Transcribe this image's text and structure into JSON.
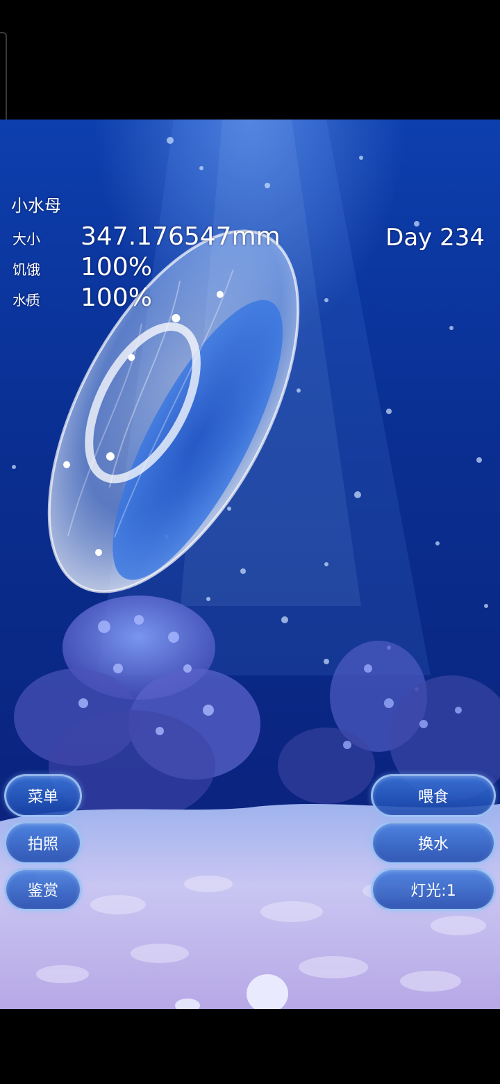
{
  "hud": {
    "pet_name": "小水母",
    "size_label": "大小",
    "size_value": "347.176547mm",
    "hunger_label": "饥饿",
    "hunger_value": "100%",
    "water_label": "水质",
    "water_value": "100%",
    "day": "Day 234"
  },
  "left_buttons": {
    "menu": "菜单",
    "photo": "拍照",
    "appreciate": "鉴赏"
  },
  "right_buttons": {
    "feed": "喂食",
    "change_water": "换水",
    "light": "灯光:1"
  },
  "colors": {
    "water_top": "#0d3fae",
    "water_bottom": "#16227a",
    "button_border": "#bedcff",
    "text": "#ffffff"
  }
}
